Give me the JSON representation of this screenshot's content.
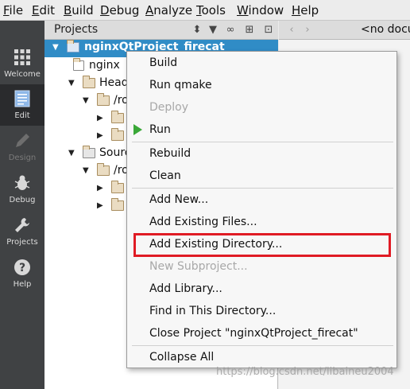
{
  "menubar": {
    "items": [
      {
        "label": "File",
        "mnemonic": "F",
        "rest": "ile"
      },
      {
        "label": "Edit",
        "mnemonic": "E",
        "rest": "dit"
      },
      {
        "label": "Build",
        "mnemonic": "B",
        "rest": "uild"
      },
      {
        "label": "Debug",
        "mnemonic": "D",
        "rest": "ebug"
      },
      {
        "label": "Analyze",
        "mnemonic": "A",
        "rest": "nalyze"
      },
      {
        "label": "Tools",
        "mnemonic": "T",
        "rest": "ools"
      },
      {
        "label": "Window",
        "mnemonic": "W",
        "rest": "indow"
      },
      {
        "label": "Help",
        "mnemonic": "H",
        "rest": "elp"
      }
    ]
  },
  "modebar": {
    "modes": [
      {
        "label": "Welcome",
        "icon": "grid-icon",
        "active": false,
        "enabled": true
      },
      {
        "label": "Edit",
        "icon": "document-icon",
        "active": true,
        "enabled": true
      },
      {
        "label": "Design",
        "icon": "pencil-icon",
        "active": false,
        "enabled": false
      },
      {
        "label": "Debug",
        "icon": "bug-icon",
        "active": false,
        "enabled": true
      },
      {
        "label": "Projects",
        "icon": "wrench-icon",
        "active": false,
        "enabled": true
      },
      {
        "label": "Help",
        "icon": "question-icon",
        "active": false,
        "enabled": true
      }
    ]
  },
  "projects_pane": {
    "title": "Projects",
    "tree": [
      {
        "text": "nginxQtProject_firecat",
        "icon": "qt-project-icon",
        "expanded": true,
        "selected": true
      },
      {
        "text": "nginx",
        "icon": "pro-file-icon"
      },
      {
        "text": "Head",
        "icon": "header-folder-icon",
        "expanded": true
      },
      {
        "text": "/ro",
        "icon": "folder-icon",
        "expanded": true
      },
      {
        "text": "",
        "icon": "folder-icon",
        "expanded": false
      },
      {
        "text": "",
        "icon": "folder-icon",
        "expanded": false
      },
      {
        "text": "Sourc",
        "icon": "source-folder-icon",
        "expanded": true
      },
      {
        "text": "/ro",
        "icon": "folder-icon",
        "expanded": true
      },
      {
        "text": "",
        "icon": "folder-icon",
        "expanded": false
      },
      {
        "text": "",
        "icon": "folder-icon",
        "expanded": false
      }
    ]
  },
  "editor": {
    "no_document": "<no docu"
  },
  "context_menu": {
    "items": [
      {
        "label": "Build",
        "enabled": true
      },
      {
        "label": "Run qmake",
        "enabled": true
      },
      {
        "label": "Deploy",
        "enabled": false
      },
      {
        "label": "Run",
        "enabled": true,
        "icon": "run-icon"
      },
      {
        "label": "Rebuild",
        "enabled": true
      },
      {
        "label": "Clean",
        "enabled": true
      },
      {
        "label": "Add New...",
        "enabled": true
      },
      {
        "label": "Add Existing Files...",
        "enabled": true
      },
      {
        "label": "Add Existing Directory...",
        "enabled": true,
        "highlighted": true
      },
      {
        "label": "New Subproject...",
        "enabled": false
      },
      {
        "label": "Add Library...",
        "enabled": true
      },
      {
        "label": "Find in This Directory...",
        "enabled": true
      },
      {
        "label": "Close Project \"nginxQtProject_firecat\"",
        "enabled": true
      },
      {
        "label": "Collapse All",
        "enabled": true
      }
    ],
    "highlight_color": "#e01b24"
  },
  "watermark": "https://blog.csdn.net/libaineu2004",
  "colors": {
    "selection": "#308cc6",
    "modebar": "#404244",
    "run_green": "#3aa838"
  }
}
